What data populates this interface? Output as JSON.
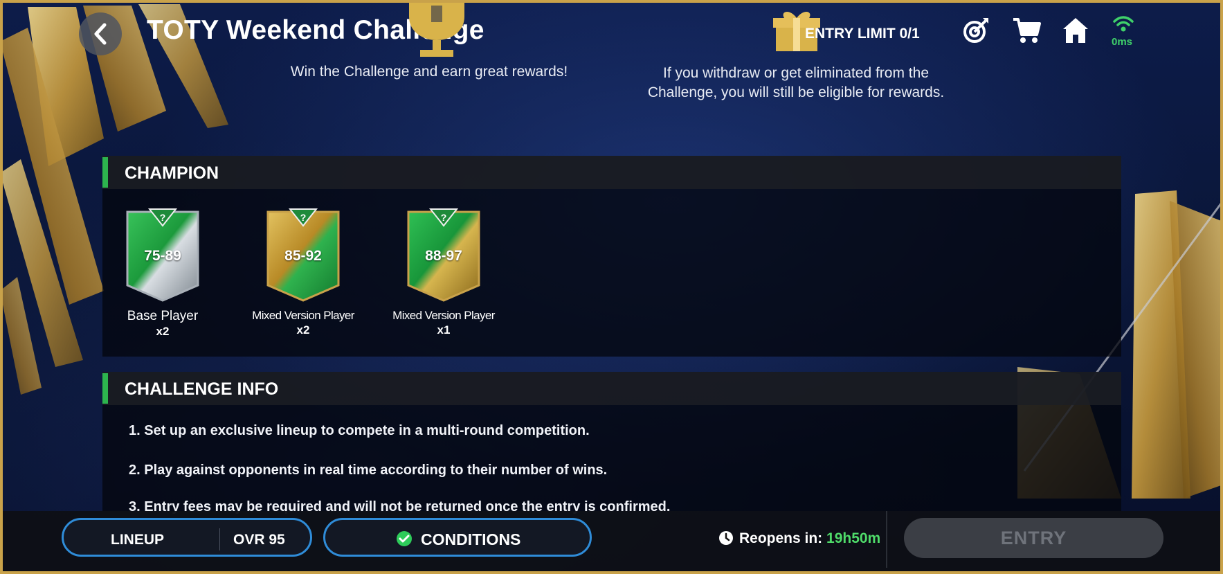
{
  "header": {
    "title": "TOTY Weekend Challenge",
    "entry_limit": "ENTRY LIMIT 0/1",
    "ping": "0ms",
    "icons": [
      "back-icon",
      "trophy-icon",
      "gift-icon",
      "target-icon",
      "cart-icon",
      "home-icon",
      "wifi-icon"
    ]
  },
  "subtitles": {
    "left": "Win the Challenge and earn great rewards!",
    "right_line1": "If you withdraw or get eliminated from the",
    "right_line2": "Challenge, you will still be eligible for rewards."
  },
  "champion": {
    "heading": "CHAMPION",
    "rewards": [
      {
        "range": "75-89",
        "name": "Base Player",
        "qty": "x2",
        "style": "silver-green"
      },
      {
        "range": "85-92",
        "name": "Mixed Version Player",
        "qty": "x2",
        "style": "gold-green"
      },
      {
        "range": "88-97",
        "name": "Mixed Version Player",
        "qty": "x1",
        "style": "green-gold"
      }
    ]
  },
  "challenge_info": {
    "heading": "CHALLENGE INFO",
    "lines": [
      "1.  Set up an exclusive lineup to compete in a multi-round competition.",
      "2.  Play against opponents in real time according to their number of wins.",
      "3.  Entry fees may be required and will not be returned once the entry is confirmed."
    ]
  },
  "footer": {
    "lineup_label": "LINEUP",
    "ovr_label": "OVR 95",
    "conditions_label": "CONDITIONS",
    "reopens_label": "Reopens in: ",
    "reopens_time": "19h50m",
    "entry_label": "ENTRY"
  },
  "colors": {
    "accent_green": "#2db44e",
    "pill_blue": "#2f8cd8",
    "gold": "#d9b34a",
    "timer_green": "#4fdc6a"
  }
}
